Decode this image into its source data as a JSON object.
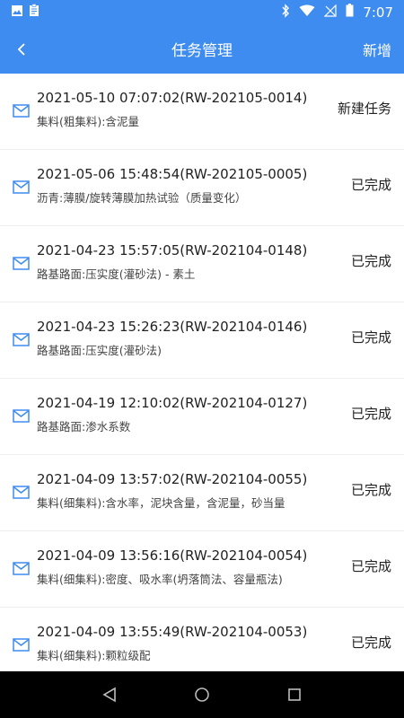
{
  "status_bar": {
    "time": "7:07",
    "icons_left": [
      "image-icon",
      "clipboard-icon"
    ],
    "icons_right": [
      "bluetooth-icon",
      "wifi-icon",
      "no-signal-icon",
      "battery-icon"
    ]
  },
  "app_bar": {
    "title": "任务管理",
    "action_label": "新增"
  },
  "colors": {
    "primary": "#3e8cf0",
    "icon_blue": "#3e8cf0"
  },
  "tasks": [
    {
      "header": "2021-05-10 07:07:02(RW-202105-0014)",
      "desc": "集料(粗集料):含泥量",
      "status": "新建任务"
    },
    {
      "header": "2021-05-06 15:48:54(RW-202105-0005)",
      "desc": "沥青:薄膜/旋转薄膜加热试验（质量变化）",
      "status": "已完成"
    },
    {
      "header": "2021-04-23 15:57:05(RW-202104-0148)",
      "desc": "路基路面:压实度(灌砂法) - 素土",
      "status": "已完成"
    },
    {
      "header": "2021-04-23 15:26:23(RW-202104-0146)",
      "desc": "路基路面:压实度(灌砂法)",
      "status": "已完成"
    },
    {
      "header": "2021-04-19 12:10:02(RW-202104-0127)",
      "desc": "路基路面:渗水系数",
      "status": "已完成"
    },
    {
      "header": "2021-04-09 13:57:02(RW-202104-0055)",
      "desc": "集料(细集料):含水率，泥块含量，含泥量，砂当量",
      "status": "已完成"
    },
    {
      "header": "2021-04-09 13:56:16(RW-202104-0054)",
      "desc": "集料(细集料):密度、吸水率(坍落筒法、容量瓶法)",
      "status": "已完成"
    },
    {
      "header": "2021-04-09 13:55:49(RW-202104-0053)",
      "desc": "集料(细集料):颗粒级配",
      "status": "已完成"
    }
  ]
}
